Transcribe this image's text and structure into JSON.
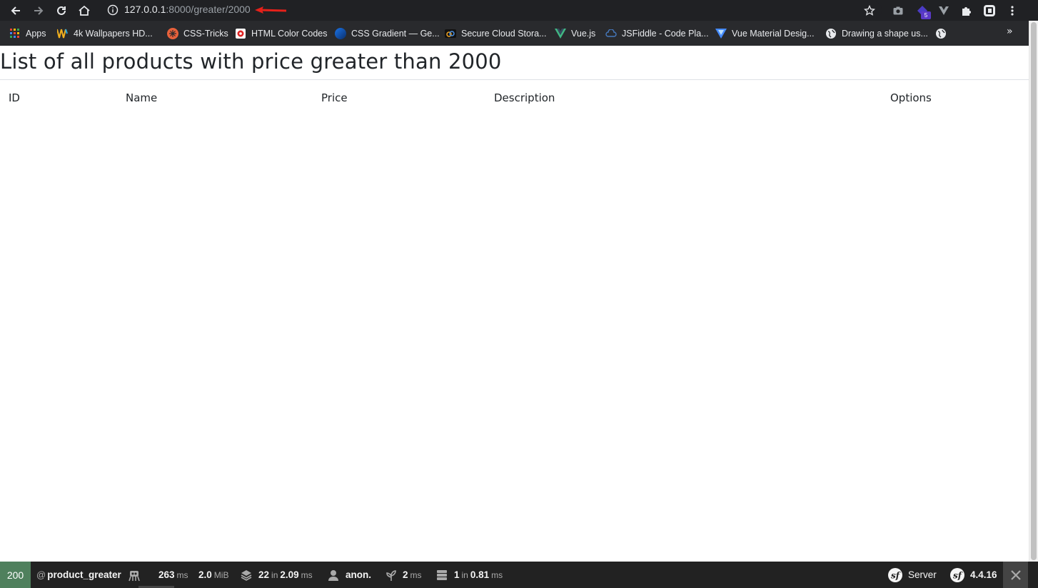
{
  "browser": {
    "url_host": "127.0.0.1",
    "url_path": ":8000/greater/2000",
    "extension_badge": "5",
    "bookmarks": [
      {
        "label": "Apps",
        "icon": "apps-grid-icon"
      },
      {
        "label": "4k Wallpapers HD...",
        "icon": "wallpapers-icon"
      },
      {
        "label": "CSS-Tricks",
        "icon": "css-tricks-icon"
      },
      {
        "label": "HTML Color Codes",
        "icon": "html-color-codes-icon"
      },
      {
        "label": "CSS Gradient — Ge...",
        "icon": "css-gradient-icon"
      },
      {
        "label": "Secure Cloud Stora...",
        "icon": "cloud-storage-icon"
      },
      {
        "label": "Vue.js",
        "icon": "vue-icon"
      },
      {
        "label": "JSFiddle - Code Pla...",
        "icon": "jsfiddle-icon"
      },
      {
        "label": "Vue Material Desig...",
        "icon": "vue-material-icon"
      },
      {
        "label": "Drawing a shape us...",
        "icon": "globe-icon"
      }
    ],
    "more_label": "»"
  },
  "page": {
    "title": "List of all products with price greater than 2000",
    "table_headers": [
      "ID",
      "Name",
      "Price",
      "Description",
      "Options"
    ]
  },
  "symfony_toolbar": {
    "status_code": "200",
    "route_prefix": "@",
    "route": "product_greater",
    "time_value": "263",
    "time_unit": "ms",
    "memory_value": "2.0",
    "memory_unit": "MiB",
    "twig_count": "22",
    "twig_in": "in",
    "twig_time": "2.09",
    "twig_unit": "ms",
    "user": "anon.",
    "cache_value": "2",
    "cache_unit": "ms",
    "db_count": "1",
    "db_in": "in",
    "db_time": "0.81",
    "db_unit": "ms",
    "server_label": "Server",
    "version": "4.4.16"
  },
  "colors": {
    "chrome_dark": "#202124",
    "bookmark_bar": "#292a2d",
    "toolbar_bg": "#222222",
    "status_ok": "#4f805d",
    "annotation_arrow": "#e5211a"
  }
}
